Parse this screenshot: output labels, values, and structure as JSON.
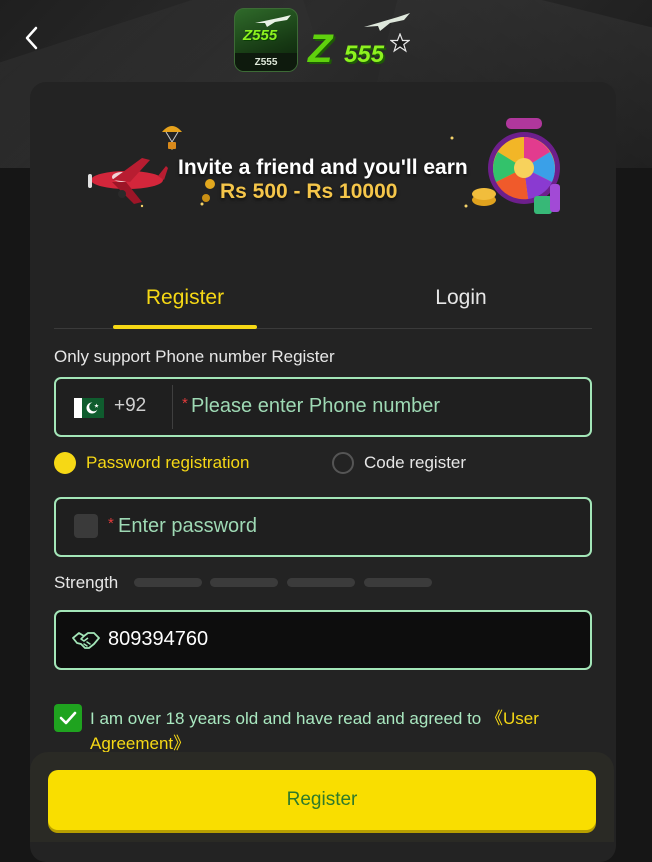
{
  "header": {
    "back_icon": "chevron-left-icon",
    "app_icon_text": "Z555",
    "app_icon_caption": "Z555",
    "wordmark_z": "Z",
    "wordmark_num": "555"
  },
  "banner": {
    "line1": "Invite a friend and you'll earn",
    "line2": "Rs 500 - Rs 10000"
  },
  "tabs": [
    {
      "label": "Register",
      "active": true
    },
    {
      "label": "Login",
      "active": false
    }
  ],
  "form": {
    "hint": "Only support Phone number Register",
    "phone": {
      "country_code": "+92",
      "required_mark": "*",
      "placeholder": "Please enter Phone number",
      "value": ""
    },
    "registration_modes": [
      {
        "label": "Password registration",
        "selected": true
      },
      {
        "label": "Code register",
        "selected": false
      }
    ],
    "password": {
      "required_mark": "*",
      "placeholder": "Enter password",
      "value": ""
    },
    "strength": {
      "label": "Strength",
      "filled_segments": 0,
      "total_segments": 4
    },
    "invite_code": {
      "value": "809394760"
    },
    "agreement": {
      "checked": true,
      "text": "I am over 18 years old and have read and agreed to ",
      "link": "《User Agreement》"
    },
    "submit_label": "Register"
  },
  "colors": {
    "accent": "#f6d815",
    "field_border": "#a3e6b8",
    "checkbox": "#1fa31f",
    "button": "#f9de00",
    "button_text": "#2f7a2a"
  }
}
